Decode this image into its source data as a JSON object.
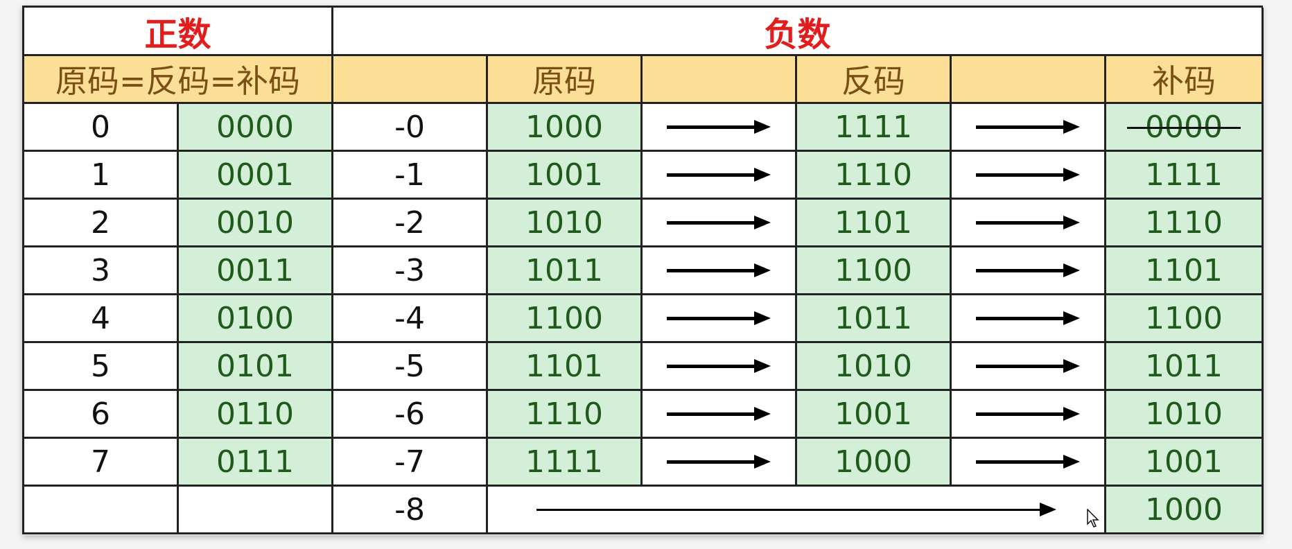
{
  "header": {
    "positive_title": "正数",
    "negative_title": "负数",
    "positive_sub": "原码=反码=补码",
    "neg_original": "原码",
    "neg_ones": "反码",
    "neg_twos": "补码"
  },
  "positive_rows": [
    {
      "n": "0",
      "code": "0000"
    },
    {
      "n": "1",
      "code": "0001"
    },
    {
      "n": "2",
      "code": "0010"
    },
    {
      "n": "3",
      "code": "0011"
    },
    {
      "n": "4",
      "code": "0100"
    },
    {
      "n": "5",
      "code": "0101"
    },
    {
      "n": "6",
      "code": "0110"
    },
    {
      "n": "7",
      "code": "0111"
    }
  ],
  "negative_rows": [
    {
      "n": "-0",
      "original": "1000",
      "ones": "1111",
      "twos": "0000"
    },
    {
      "n": "-1",
      "original": "1001",
      "ones": "1110",
      "twos": "1111"
    },
    {
      "n": "-2",
      "original": "1010",
      "ones": "1101",
      "twos": "1110"
    },
    {
      "n": "-3",
      "original": "1011",
      "ones": "1100",
      "twos": "1101"
    },
    {
      "n": "-4",
      "original": "1100",
      "ones": "1011",
      "twos": "1100"
    },
    {
      "n": "-5",
      "original": "1101",
      "ones": "1010",
      "twos": "1011"
    },
    {
      "n": "-6",
      "original": "1110",
      "ones": "1001",
      "twos": "1010"
    },
    {
      "n": "-7",
      "original": "1111",
      "ones": "1000",
      "twos": "1001"
    }
  ],
  "last_row": {
    "n": "-8",
    "twos": "1000"
  },
  "colors": {
    "red": "#e21d1d",
    "header_bg": "#fbdf97",
    "header_text": "#7a4f15",
    "green_bg": "#d4efd8",
    "green_text": "#1f5a1c"
  },
  "icons": {
    "arrow": "right-arrow-icon",
    "cursor": "mouse-cursor-icon"
  }
}
